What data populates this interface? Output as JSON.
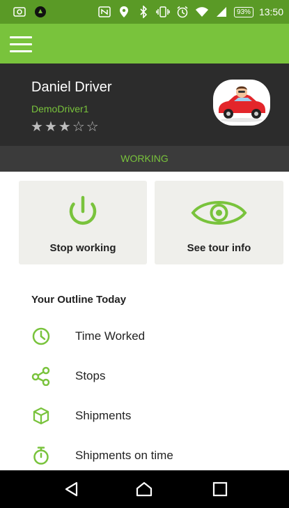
{
  "status_bar": {
    "battery": "93%",
    "time": "13:50"
  },
  "driver": {
    "name": "Daniel Driver",
    "username": "DemoDriver1",
    "rating": 3,
    "rating_max": 5
  },
  "status": "WORKING",
  "actions": [
    {
      "label": "Stop working",
      "icon": "power-icon"
    },
    {
      "label": "See tour info",
      "icon": "eye-icon"
    }
  ],
  "outline": {
    "title": "Your Outline Today",
    "items": [
      {
        "label": "Time Worked",
        "icon": "clock-icon"
      },
      {
        "label": "Stops",
        "icon": "share-nodes-icon"
      },
      {
        "label": "Shipments",
        "icon": "box-icon"
      },
      {
        "label": "Shipments on time",
        "icon": "stopwatch-icon"
      }
    ]
  },
  "colors": {
    "accent": "#79c33c",
    "status_bar": "#5a9a26",
    "header_dark": "#2c2c2c"
  }
}
